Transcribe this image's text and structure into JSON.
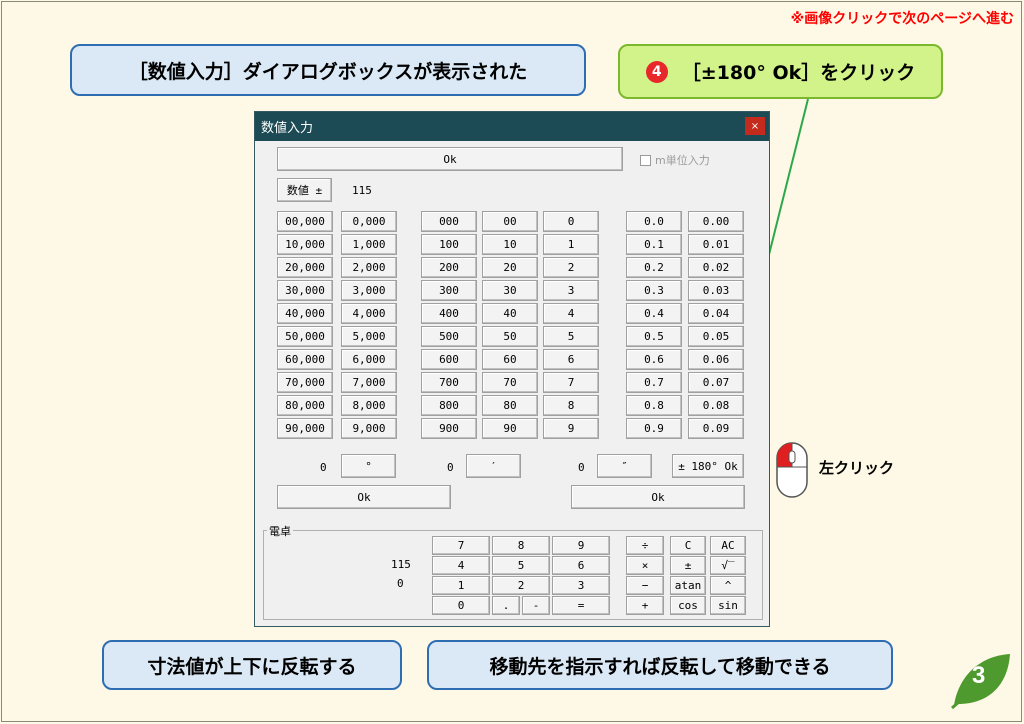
{
  "hint": "※画像クリックで次のページへ進む",
  "callouts": {
    "top_left": "［数値入力］ダイアログボックスが表示された",
    "step_num": "4",
    "step_text": "［±180° Ok］をクリック",
    "bottom_left": "寸法値が上下に反転する",
    "bottom_right": "移動先を指示すれば反転して移動できる"
  },
  "dialog": {
    "title": "数値入力",
    "close": "×",
    "ok_top": "Ok",
    "meter_checkbox": "m単位入力",
    "value_button": "数値 ±",
    "value": "115",
    "col1": [
      "00,000",
      "10,000",
      "20,000",
      "30,000",
      "40,000",
      "50,000",
      "60,000",
      "70,000",
      "80,000",
      "90,000"
    ],
    "col2": [
      "0,000",
      "1,000",
      "2,000",
      "3,000",
      "4,000",
      "5,000",
      "6,000",
      "7,000",
      "8,000",
      "9,000"
    ],
    "col3": [
      "000",
      "100",
      "200",
      "300",
      "400",
      "500",
      "600",
      "700",
      "800",
      "900"
    ],
    "col4": [
      "00",
      "10",
      "20",
      "30",
      "40",
      "50",
      "60",
      "70",
      "80",
      "90"
    ],
    "col5": [
      "0",
      "1",
      "2",
      "3",
      "4",
      "5",
      "6",
      "7",
      "8",
      "9"
    ],
    "col6": [
      "0.0",
      "0.1",
      "0.2",
      "0.3",
      "0.4",
      "0.5",
      "0.6",
      "0.7",
      "0.8",
      "0.9"
    ],
    "col7": [
      "0.00",
      "0.01",
      "0.02",
      "0.03",
      "0.04",
      "0.05",
      "0.06",
      "0.07",
      "0.08",
      "0.09"
    ],
    "deg_value": "0",
    "deg_btn": "°",
    "min_value": "0",
    "min_btn": "′",
    "sec_value": "0",
    "sec_btn": "″",
    "rot_btn": "± 180° Ok",
    "ok_left": "Ok",
    "ok_right": "Ok"
  },
  "calc": {
    "title": "電卓",
    "display1": "115",
    "display2": "0",
    "row1": [
      "7",
      "8",
      "9"
    ],
    "row2": [
      "4",
      "5",
      "6"
    ],
    "row3": [
      "1",
      "2",
      "3"
    ],
    "row4": [
      "0",
      ".",
      "-",
      "="
    ],
    "ops": [
      "÷",
      "×",
      "−",
      "+"
    ],
    "func1": [
      "C",
      "±",
      "atan",
      "cos"
    ],
    "func2": [
      "AC",
      "√‾",
      "^",
      "sin"
    ]
  },
  "annotation": {
    "left_click": "左クリック"
  },
  "page_number": "3",
  "colors": {
    "background": "#fdf9e6",
    "callout_blue": "#dbe9f6",
    "callout_green": "#d2f38a",
    "leaf": "#4e9a2f",
    "pointer_line": "#2ca84a"
  }
}
